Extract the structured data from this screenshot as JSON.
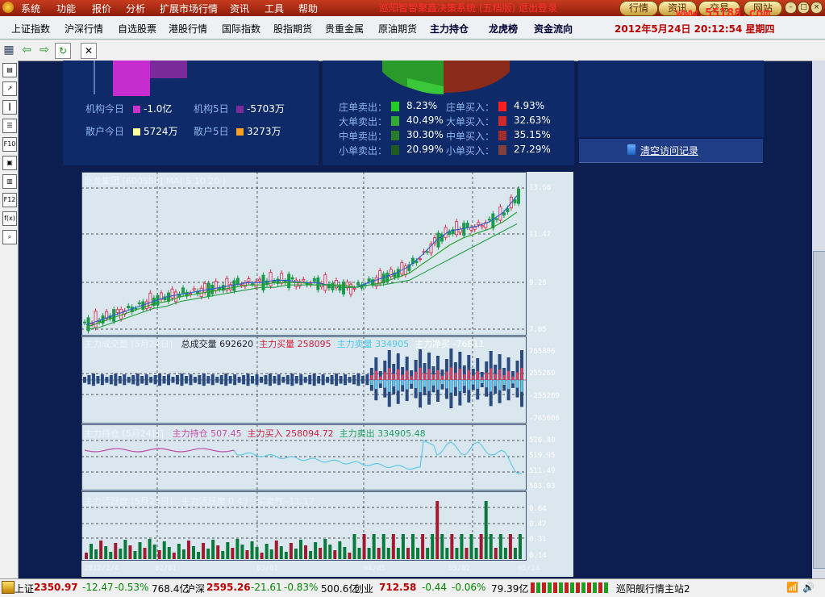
{
  "menu": {
    "items": [
      "系统",
      "功能",
      "报价",
      "分析",
      "扩展市场行情",
      "资讯",
      "工具",
      "帮助"
    ],
    "title": "巡阳智智聚鑫决策系统 (五档版) 退出登录",
    "pills": [
      "行情",
      "资讯",
      "交易",
      "网站"
    ],
    "watermark": "www.55188.com"
  },
  "nav": {
    "items": [
      "上证指数",
      "沪深行情",
      "自选股票",
      "港股行情",
      "国际指数",
      "股指期货",
      "贵重金属",
      "原油期货",
      "主力持仓",
      "龙虎榜",
      "资金流向"
    ],
    "datetime": "2012年5月24日  20:12:54  星期四"
  },
  "flow": {
    "left": [
      {
        "label": "机构今日",
        "value": "-1.0亿",
        "color": "#cc33cc"
      },
      {
        "label": "机构5日",
        "value": "-5703万",
        "color": "#7a2a9a"
      },
      {
        "label": "散户今日",
        "value": "5724万",
        "color": "#ffff99"
      },
      {
        "label": "散户5日",
        "value": "3273万",
        "color": "#ffa020"
      }
    ],
    "mid": [
      {
        "label": "庄单卖出：",
        "value": "8.23%",
        "color": "#22cc22"
      },
      {
        "label": "庄单买入：",
        "value": "4.93%",
        "color": "#ff2020"
      },
      {
        "label": "大单卖出：",
        "value": "40.49%",
        "color": "#33aa33"
      },
      {
        "label": "大单买入：",
        "value": "32.63%",
        "color": "#cc2a2a"
      },
      {
        "label": "中单卖出：",
        "value": "30.30%",
        "color": "#2a7a2a"
      },
      {
        "label": "中单买入：",
        "value": "35.15%",
        "color": "#a03030"
      },
      {
        "label": "小单卖出：",
        "value": "20.99%",
        "color": "#205a20"
      },
      {
        "label": "小单买入：",
        "value": "27.29%",
        "color": "#804040"
      }
    ]
  },
  "clear_history": "清空访问记录",
  "panes": {
    "k": {
      "title": "卧龙集团 [600580] MA( 5 10 20 )",
      "axis": [
        "13.68",
        "11.47",
        "9.26",
        "7.05"
      ]
    },
    "vol": {
      "title": "主力成交量 [5月24日]",
      "labels": [
        "总成交量",
        "692620",
        "主力买量",
        "258095",
        "主力卖量",
        "334905",
        "主力净买",
        "-76811"
      ],
      "axis": [
        "765806",
        "255269",
        "-255269",
        "-765606"
      ]
    },
    "hold": {
      "title": "主力持仓 [5月24日]",
      "labels": [
        "主力持仓",
        "507.45",
        "主力买入",
        "258094.72",
        "主力卖出",
        "334905.48"
      ],
      "axis": [
        "526.40",
        "519.95",
        "511.49",
        "503.03"
      ]
    },
    "act": {
      "title": "主力活跃度 [5月24日]",
      "labels": [
        "主力活跃度",
        "0.43",
        "买卖气",
        "-11.17"
      ],
      "axis": [
        "0.64",
        "0.47",
        "0.31",
        "0.14"
      ]
    }
  },
  "chart_data": {
    "type": "line",
    "title": "卧龙集团 [600580] MA( 5 10 20 )",
    "x_ticks": [
      "2012/1/4",
      "02/01",
      "03/01",
      "04/05",
      "05/02",
      "05/24"
    ],
    "y_ticks": [
      13.68,
      11.47,
      9.26,
      7.05
    ],
    "ylim": [
      7.05,
      13.68
    ],
    "series": [
      {
        "name": "MA5",
        "values": [
          7.3,
          7.5,
          7.7,
          7.9,
          8.1,
          8.3,
          8.5,
          8.6,
          8.7,
          8.8,
          8.9,
          9.0,
          9.1,
          9.1,
          9.2,
          9.2,
          9.1,
          9.1,
          9.0,
          8.9,
          8.9,
          9.1,
          9.3,
          9.5,
          9.8,
          10.3,
          10.9,
          11.3,
          11.4,
          11.5,
          11.7,
          12.1,
          12.8
        ]
      },
      {
        "name": "MA10",
        "values": [
          7.2,
          7.4,
          7.6,
          7.8,
          8.0,
          8.2,
          8.3,
          8.5,
          8.6,
          8.7,
          8.8,
          8.9,
          9.0,
          9.0,
          9.1,
          9.1,
          9.1,
          9.0,
          9.0,
          9.0,
          8.9,
          9.0,
          9.1,
          9.3,
          9.5,
          9.9,
          10.3,
          10.7,
          11.0,
          11.2,
          11.4,
          11.7,
          12.1
        ]
      },
      {
        "name": "MA20",
        "values": [
          7.1,
          7.2,
          7.4,
          7.6,
          7.8,
          8.0,
          8.1,
          8.3,
          8.4,
          8.5,
          8.6,
          8.7,
          8.8,
          8.9,
          8.9,
          9.0,
          9.0,
          9.0,
          9.0,
          8.9,
          8.9,
          9.0,
          9.0,
          9.1,
          9.2,
          9.5,
          9.8,
          10.1,
          10.4,
          10.7,
          11.0,
          11.3,
          11.6
        ]
      }
    ]
  },
  "status": {
    "sh_label": "上证",
    "sh": "2350.97",
    "sh_chg": "-12.47",
    "sh_pct": "-0.53%",
    "sh_amt": "768.4亿",
    "sz_label": "沪深",
    "sz": "2595.26",
    "sz_chg": "-21.61",
    "sz_pct": "-0.83%",
    "sz_amt": "500.6亿",
    "cy_label": "创业",
    "cy": "712.58",
    "cy_chg": "-0.44",
    "cy_pct": "-0.06%",
    "cy_amt": "79.39亿",
    "station": "巡阳舰行情主站2"
  },
  "colors": {
    "up": "#d8284a",
    "down": "#1a9a4a",
    "ma5": "#2860d0",
    "ma10": "#20a020",
    "accent": "#b00000"
  }
}
